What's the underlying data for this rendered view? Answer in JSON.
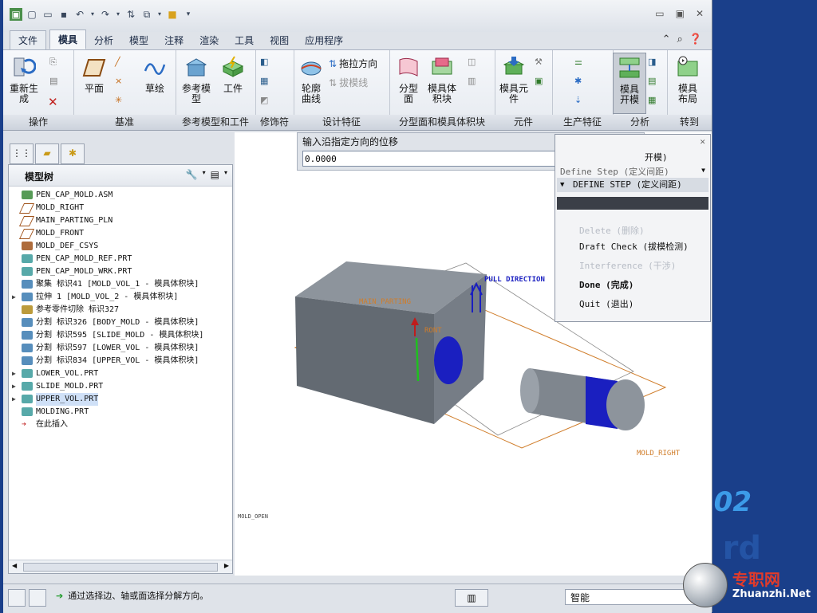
{
  "app": {
    "title": "",
    "tabs": [
      "文件",
      "模具",
      "分析",
      "模型",
      "注释",
      "渲染",
      "工具",
      "视图",
      "应用程序"
    ],
    "active_tab": "模具"
  },
  "ribbon": {
    "groups": [
      {
        "label": "操作",
        "buttons": [
          "重新生成"
        ]
      },
      {
        "label": "基准",
        "buttons": [
          "平面",
          "草绘"
        ]
      },
      {
        "label": "参考模型和工件",
        "buttons": [
          "参考模型",
          "工件"
        ]
      },
      {
        "label": "修饰符",
        "buttons": []
      },
      {
        "label": "设计特征",
        "buttons": [
          "轮廓曲线",
          "拖拉方向",
          "拔模线"
        ]
      },
      {
        "label": "分型面和模具体积块",
        "buttons": [
          "分型面",
          "模具体积块"
        ]
      },
      {
        "label": "元件",
        "buttons": [
          "模具元件"
        ]
      },
      {
        "label": "生产特征",
        "buttons": []
      },
      {
        "label": "分析",
        "buttons": [
          "模具开模"
        ]
      },
      {
        "label": "转到",
        "buttons": [
          "模具布局"
        ]
      }
    ],
    "btn_labels": {
      "regen_1": "重新生",
      "regen_2": "成",
      "plane": "平面",
      "sketch": "草绘",
      "refmodel_1": "参考模",
      "refmodel_2": "型",
      "work": "工件",
      "outline_1": "轮廓",
      "outline_2": "曲线",
      "pull": "拖拉方向",
      "draftline": "拔模线",
      "parting_1": "分型",
      "parting_2": "面",
      "vol_1": "模具体",
      "vol_2": "积块",
      "comp_1": "模具元",
      "comp_2": "件",
      "open_1": "模具",
      "open_2": "开模",
      "layout_1": "模具",
      "layout_2": "布局"
    }
  },
  "model_tree": {
    "title": "模型树",
    "items": [
      {
        "text": "PEN_CAP_MOLD.ASM",
        "expand": "",
        "icon": "assembly-icon"
      },
      {
        "text": "MOLD_RIGHT",
        "expand": "",
        "icon": "datum-plane-icon"
      },
      {
        "text": "MAIN_PARTING_PLN",
        "expand": "",
        "icon": "datum-plane-icon"
      },
      {
        "text": "MOLD_FRONT",
        "expand": "",
        "icon": "datum-plane-icon"
      },
      {
        "text": "MOLD_DEF_CSYS",
        "expand": "",
        "icon": "csys-icon"
      },
      {
        "text": "PEN_CAP_MOLD_REF.PRT",
        "expand": "",
        "icon": "part-icon"
      },
      {
        "text": "PEN_CAP_MOLD_WRK.PRT",
        "expand": "",
        "icon": "part-icon"
      },
      {
        "text": "聚集 标识41 [MOLD_VOL_1 - 模具体积块]",
        "expand": "",
        "icon": "volume-icon"
      },
      {
        "text": "拉伸 1 [MOLD_VOL_2 - 模具体积块]",
        "expand": "▶",
        "icon": "volume-icon"
      },
      {
        "text": "参考零件切除 标识327",
        "expand": "",
        "icon": "cut-icon"
      },
      {
        "text": "分割 标识326 [BODY_MOLD - 模具体积块]",
        "expand": "",
        "icon": "volume-icon"
      },
      {
        "text": "分割 标识595 [SLIDE_MOLD - 模具体积块]",
        "expand": "",
        "icon": "volume-icon"
      },
      {
        "text": "分割 标识597 [LOWER_VOL - 模具体积块]",
        "expand": "",
        "icon": "volume-icon"
      },
      {
        "text": "分割 标识834 [UPPER_VOL - 模具体积块]",
        "expand": "",
        "icon": "volume-icon"
      },
      {
        "text": "LOWER_VOL.PRT",
        "expand": "▶",
        "icon": "part-icon"
      },
      {
        "text": "SLIDE_MOLD.PRT",
        "expand": "▶",
        "icon": "part-icon"
      },
      {
        "text": "UPPER_VOL.PRT",
        "expand": "▶",
        "icon": "part-icon",
        "selected": true
      },
      {
        "text": "MOLDING.PRT",
        "expand": "",
        "icon": "molding-icon"
      },
      {
        "text": "在此插入",
        "expand": "",
        "icon": "insert-arrow-icon"
      }
    ]
  },
  "input_bar": {
    "label": "输入沿指定方向的位移",
    "value": "0.0000"
  },
  "menu_manager": {
    "item_open": "开模)",
    "item_define": "Define Step (定义间距)",
    "header": "DEFINE STEP (定义间距)",
    "delete": "Delete (删除)",
    "draft": "Draft Check (拔模检测)",
    "interference": "Interference (干涉)",
    "done": "Done (完成)",
    "quit": "Quit (退出)"
  },
  "viewport": {
    "pull_direction": "PULL DIRECTION",
    "main_parting": "MAIN_PARTING",
    "front": "RONT",
    "mold_right": "MOLD_RIGHT",
    "mold_open": "MOLD_OPEN"
  },
  "status": {
    "message": "通过选择边、轴或面选择分解方向。",
    "filter": "智能"
  },
  "watermark": {
    "text": "专职网",
    "url": "Zhuanzhi.Net"
  },
  "colors": {
    "ribbon_bg": "#e6eaf0",
    "cylinder_blue": "#1a1fc0",
    "part_gray": "#6f7780",
    "parting_orange": "#d07d2a"
  }
}
